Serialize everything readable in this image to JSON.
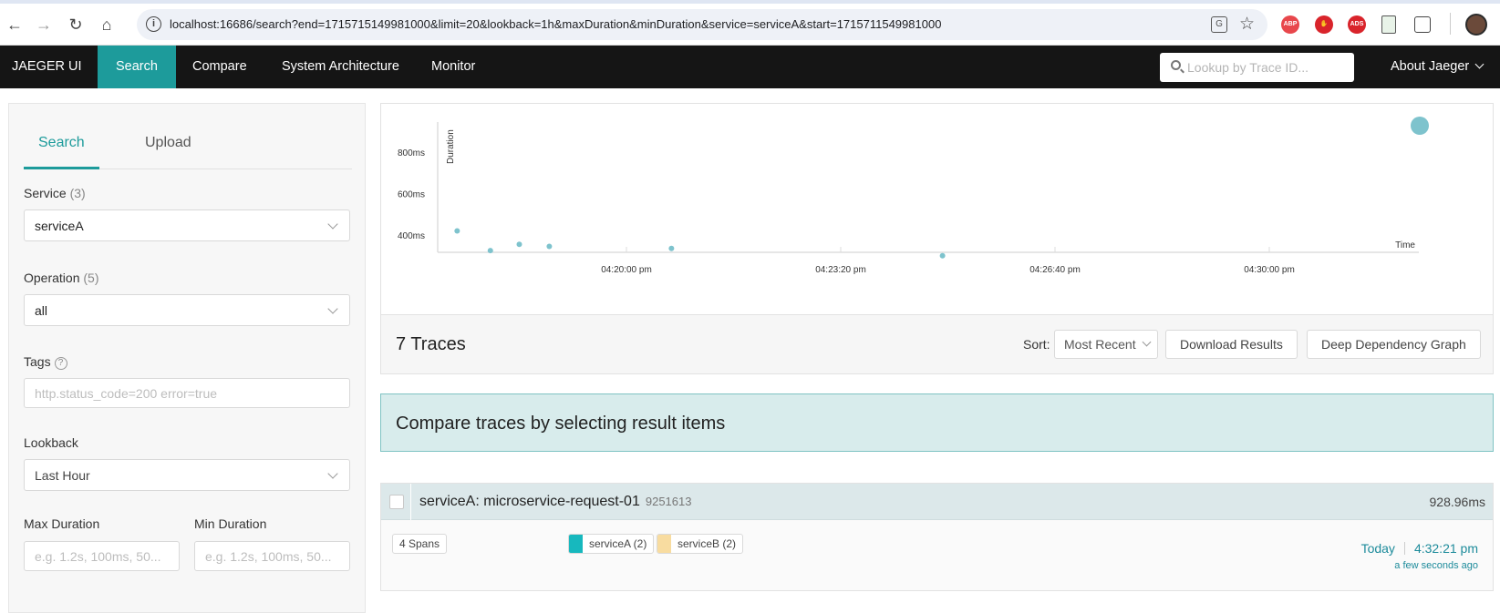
{
  "browser": {
    "url": "localhost:16686/search?end=1715715149981000&limit=20&lookback=1h&maxDuration&minDuration&service=serviceA&start=1715711549981000",
    "extensions": [
      {
        "name": "abp-icon",
        "label": "ABP",
        "color": "#e8474c"
      },
      {
        "name": "stop-hand-icon",
        "label": "✋",
        "color": "#d9242b"
      },
      {
        "name": "ads-icon",
        "label": "ADS",
        "color": "#d9242b"
      }
    ]
  },
  "nav": {
    "brand": "JAEGER UI",
    "items": [
      {
        "label": "Search",
        "active": true
      },
      {
        "label": "Compare",
        "active": false
      },
      {
        "label": "System Architecture",
        "active": false
      },
      {
        "label": "Monitor",
        "active": false
      }
    ],
    "lookup_placeholder": "Lookup by Trace ID...",
    "about": "About Jaeger"
  },
  "search_panel": {
    "tabs": [
      "Search",
      "Upload"
    ],
    "service_label": "Service",
    "service_count": "(3)",
    "service_value": "serviceA",
    "operation_label": "Operation",
    "operation_count": "(5)",
    "operation_value": "all",
    "tags_label": "Tags",
    "tags_help": "?",
    "tags_placeholder": "http.status_code=200 error=true",
    "lookback_label": "Lookback",
    "lookback_value": "Last Hour",
    "max_duration_label": "Max Duration",
    "min_duration_label": "Min Duration",
    "duration_placeholder": "e.g. 1.2s, 100ms, 50..."
  },
  "chart_data": {
    "type": "scatter",
    "xlabel": "Time",
    "ylabel": "Duration",
    "x_ticks": [
      "04:20:00 pm",
      "04:23:20 pm",
      "04:26:40 pm",
      "04:30:00 pm"
    ],
    "y_ticks": [
      "400ms",
      "600ms",
      "800ms"
    ],
    "points": [
      {
        "x": "04:17:22 pm",
        "y": 420
      },
      {
        "x": "04:17:53 pm",
        "y": 325
      },
      {
        "x": "04:18:20 pm",
        "y": 355
      },
      {
        "x": "04:18:48 pm",
        "y": 345
      },
      {
        "x": "04:20:42 pm",
        "y": 335
      },
      {
        "x": "04:24:55 pm",
        "y": 300
      },
      {
        "x": "04:32:21 pm",
        "y": 929
      }
    ],
    "point_color": "#7ec3cd"
  },
  "results": {
    "count_label": "7 Traces",
    "sort_label": "Sort:",
    "sort_value": "Most Recent",
    "download_label": "Download Results",
    "ddg_label": "Deep Dependency Graph"
  },
  "compare_banner": "Compare traces by selecting result items",
  "trace": {
    "title": "serviceA: microservice-request-01",
    "trace_id": "9251613",
    "duration": "928.96ms",
    "spans": "4 Spans",
    "services": [
      {
        "label": "serviceA (2)",
        "color": "#17b8be"
      },
      {
        "label": "serviceB (2)",
        "color": "#f8dcA0"
      }
    ],
    "date": "Today",
    "time": "4:32:21 pm",
    "ago": "a few seconds ago"
  }
}
